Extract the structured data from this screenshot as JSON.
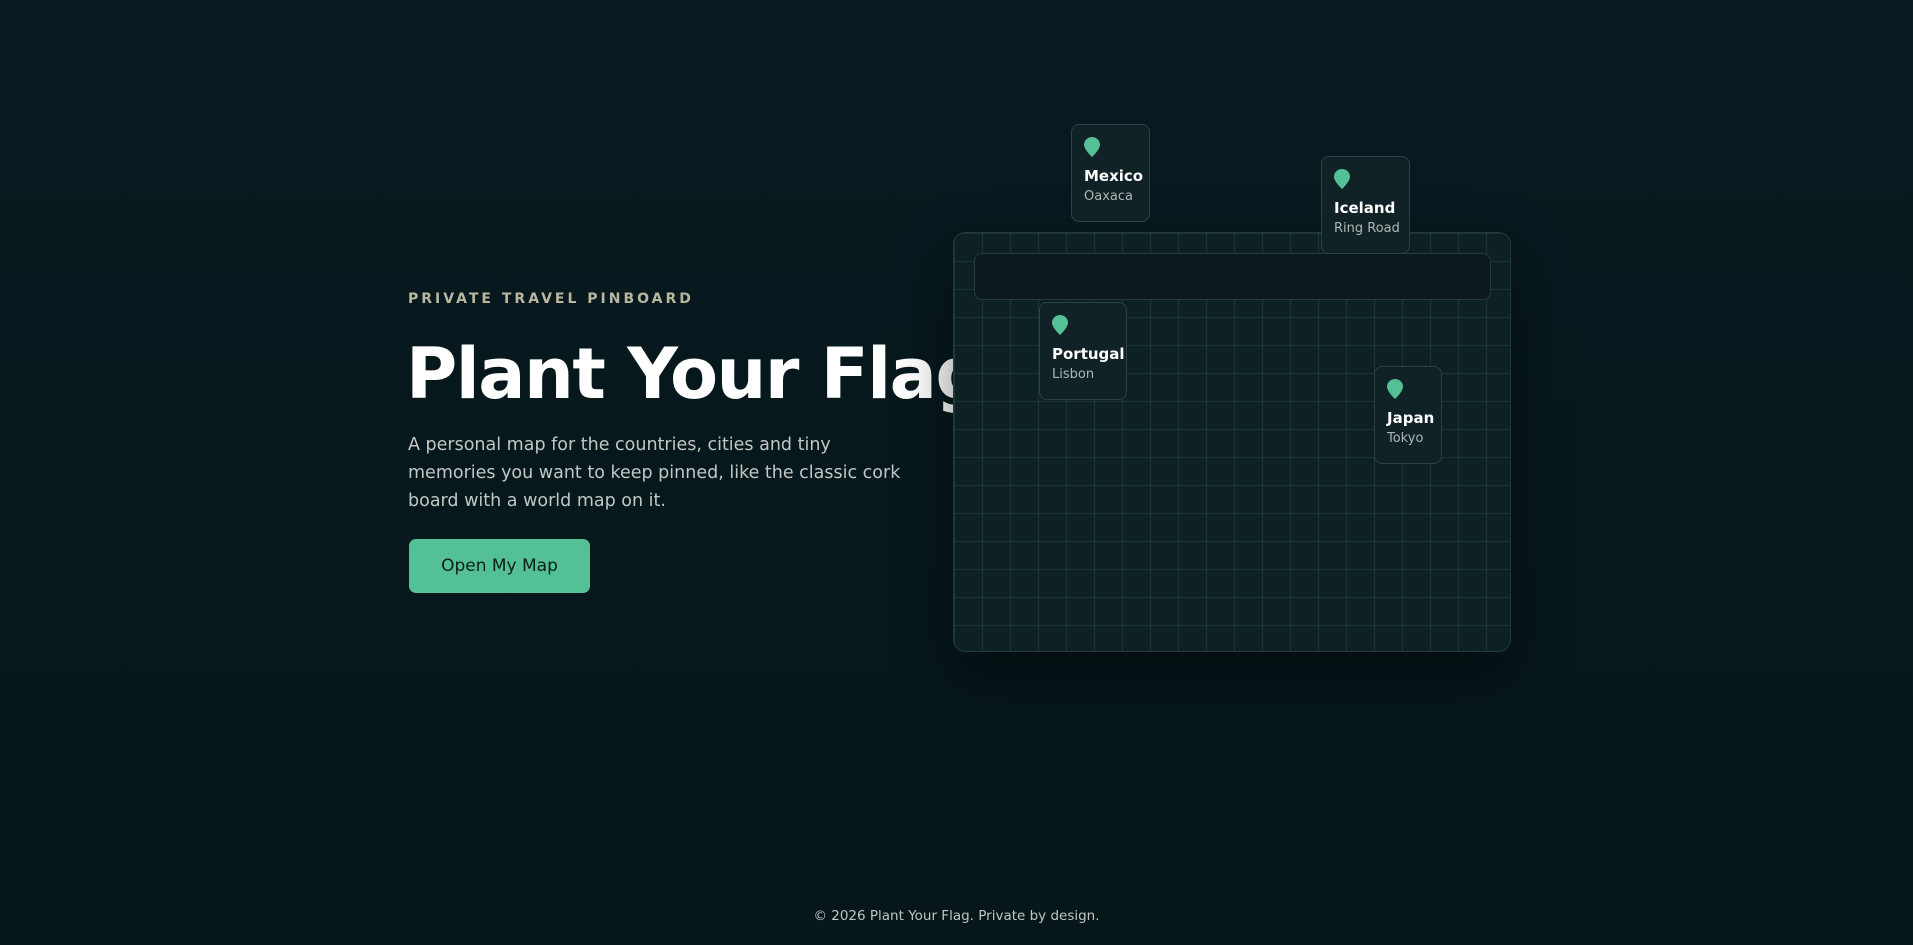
{
  "hero": {
    "eyebrow": "PRIVATE TRAVEL PINBOARD",
    "title": "Plant Your Flag",
    "description": "A personal map for the countries, cities and tiny memories you want to keep pinned, like the classic cork board with a world map on it.",
    "cta_label": "Open My Map"
  },
  "pins": [
    {
      "country": "Mexico",
      "place": "Oaxaca",
      "icon": "map-pin-icon"
    },
    {
      "country": "Iceland",
      "place": "Ring Road",
      "icon": "map-pin-icon"
    },
    {
      "country": "Portugal",
      "place": "Lisbon",
      "icon": "map-pin-icon"
    },
    {
      "country": "Japan",
      "place": "Tokyo",
      "icon": "map-pin-icon"
    }
  ],
  "footer": {
    "text": "© 2026 Plant Your Flag. Private by design."
  },
  "colors": {
    "background": "#06161c",
    "accent": "#54c096",
    "eyebrow": "#b9b79f",
    "board": "#0d2024"
  }
}
